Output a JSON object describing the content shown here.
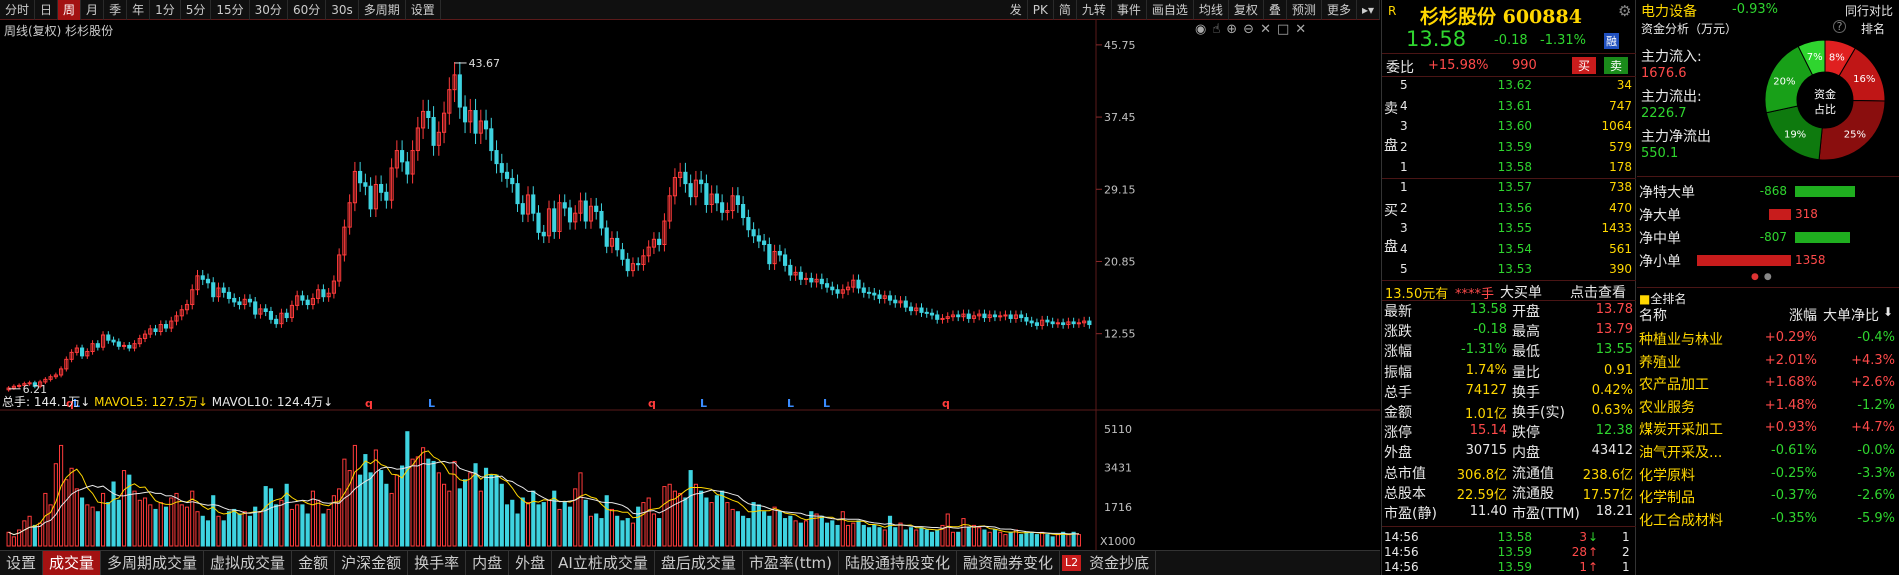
{
  "toolbar": {
    "items": [
      "分时",
      "日",
      "周",
      "月",
      "季",
      "年",
      "1分",
      "5分",
      "15分",
      "30分",
      "60分",
      "30s",
      "多周期",
      "设置"
    ],
    "active": "周",
    "right_items": [
      "发",
      "PK",
      "简",
      "九转",
      "事件",
      "画自选",
      "均线",
      "复权",
      "叠",
      "预测",
      "更多"
    ]
  },
  "chart": {
    "subtitle": "周线(复权) 杉杉股份",
    "max_label": "43.67",
    "min_label": "6.21",
    "price_ticks": [
      "45.75",
      "37.45",
      "29.15",
      "20.85",
      "12.55"
    ],
    "vol_ticks": [
      "5110",
      "3431",
      "1716",
      "X1000"
    ],
    "markers": [
      "q",
      "L",
      "q",
      "L",
      "q",
      "L",
      "L",
      "L",
      "q"
    ]
  },
  "volume_legend": {
    "total": "总手: 144.1万↓",
    "ma5": "MAVOL5: 127.5万↓",
    "ma10": "MAVOL10: 124.4万↓"
  },
  "bottom_tabs": [
    "设置",
    "成交量",
    "多周期成交量",
    "虚拟成交量",
    "金额",
    "沪深金额",
    "换手率",
    "内盘",
    "外盘",
    "AI立桩成交量",
    "盘后成交量",
    "市盈率(ttm)",
    "陆股通持股变化",
    "融资融券变化",
    "资金抄底"
  ],
  "bottom_active": "成交量",
  "bottom_badge": "L2",
  "quote": {
    "title": "杉杉股份 600884",
    "price": "13.58",
    "change": "-0.18",
    "pct": "-1.31%",
    "badge": "融",
    "r_icon": "R"
  },
  "weibi": {
    "label": "委比",
    "value": "+15.98%",
    "diff": "990",
    "buy": "买",
    "sell": "卖"
  },
  "sell_book": [
    [
      "5",
      "13.62",
      "34"
    ],
    [
      "4",
      "13.61",
      "747"
    ],
    [
      "3",
      "13.60",
      "1064"
    ],
    [
      "2",
      "13.59",
      "579"
    ],
    [
      "1",
      "13.58",
      "178"
    ]
  ],
  "buy_book": [
    [
      "1",
      "13.57",
      "738"
    ],
    [
      "2",
      "13.56",
      "470"
    ],
    [
      "3",
      "13.55",
      "1433"
    ],
    [
      "4",
      "13.54",
      "561"
    ],
    [
      "5",
      "13.53",
      "390"
    ]
  ],
  "book_side_labels": {
    "sell": [
      "卖",
      "盘"
    ],
    "buy": [
      "买",
      "盘"
    ]
  },
  "bigorder": {
    "price": "13.50元有",
    "hand": "****手",
    "label": "大买单",
    "link": "点击查看"
  },
  "stats": [
    [
      "最新",
      "13.58",
      "开盘",
      "13.78"
    ],
    [
      "涨跌",
      "-0.18",
      "最高",
      "13.79"
    ],
    [
      "涨幅",
      "-1.31%",
      "最低",
      "13.55"
    ],
    [
      "振幅",
      "1.74%",
      "量比",
      "0.91"
    ],
    [
      "总手",
      "74127",
      "换手",
      "0.42%"
    ],
    [
      "金额",
      "1.01亿",
      "换手(实)",
      "0.63%"
    ],
    [
      "涨停",
      "15.14",
      "跌停",
      "12.38"
    ],
    [
      "外盘",
      "30715",
      "内盘",
      "43412"
    ],
    [
      "总市值",
      "306.8亿",
      "流通值",
      "238.6亿"
    ],
    [
      "总股本",
      "22.59亿",
      "流通股",
      "17.57亿"
    ],
    [
      "市盈(静)",
      "11.40",
      "市盈(TTM)",
      "18.21"
    ]
  ],
  "ticks": [
    [
      "14:56",
      "13.58",
      "3",
      "↓",
      "1"
    ],
    [
      "14:56",
      "13.59",
      "28",
      "↑",
      "2"
    ],
    [
      "14:56",
      "13.59",
      "1",
      "↑",
      "1"
    ]
  ],
  "sector": {
    "name": "电力设备",
    "pct": "-0.93%",
    "link": "同行对比"
  },
  "fund": {
    "title": "资金分析（万元）",
    "more": "?",
    "rank": "排名",
    "inflow_label": "主力流入:",
    "inflow": "1676.6",
    "outflow_label": "主力流出:",
    "outflow": "2226.7",
    "net_label": "主力净流出",
    "net": "550.1",
    "donut_center1": "资金",
    "donut_center2": "占比",
    "slices": [
      {
        "label": "8%",
        "value": 8,
        "color": "#e02020"
      },
      {
        "label": "16%",
        "value": 16,
        "color": "#c01616"
      },
      {
        "label": "25%",
        "value": 25,
        "color": "#8a0e0e"
      },
      {
        "label": "19%",
        "value": 19,
        "color": "#0e7a0e"
      },
      {
        "label": "20%",
        "value": 20,
        "color": "#18a018"
      },
      {
        "label": "7%",
        "value": 7,
        "color": "#2fd52f"
      }
    ]
  },
  "net_rows": [
    {
      "label": "净特大单",
      "value": "-868",
      "frac": 0.64,
      "color": "green"
    },
    {
      "label": "净大单",
      "value": "318",
      "frac": 0.23,
      "color": "red"
    },
    {
      "label": "净中单",
      "value": "-807",
      "frac": 0.59,
      "color": "green"
    },
    {
      "label": "净小单",
      "value": "1358",
      "frac": 1.0,
      "color": "red"
    }
  ],
  "ranking": {
    "title": "全排名",
    "headers": [
      "名称",
      "涨幅",
      "大单净比"
    ],
    "rows": [
      [
        "种植业与林业",
        "+0.29%",
        "-0.4%"
      ],
      [
        "养殖业",
        "+2.01%",
        "+4.3%"
      ],
      [
        "农产品加工",
        "+1.68%",
        "+2.6%"
      ],
      [
        "农业服务",
        "+1.48%",
        "-1.2%"
      ],
      [
        "煤炭开采加工",
        "+0.93%",
        "+4.7%"
      ],
      [
        "油气开采及...",
        "-0.61%",
        "-0.0%"
      ],
      [
        "化学原料",
        "-0.25%",
        "-3.3%"
      ],
      [
        "化学制品",
        "-0.37%",
        "-2.6%"
      ],
      [
        "化工合成材料",
        "-0.35%",
        "-5.9%"
      ]
    ]
  },
  "chart_data": {
    "type": "candlestick",
    "x_unit": "week",
    "ylim": [
      5.5,
      47
    ],
    "price_ticks": [
      45.75,
      37.45,
      29.15,
      20.85,
      12.55
    ],
    "high_marker": 43.67,
    "low_marker": 6.21,
    "closes": [
      6.3,
      6.5,
      6.6,
      6.8,
      6.9,
      6.5,
      7.0,
      7.3,
      7.6,
      7.8,
      8.5,
      9.6,
      10.4,
      10.9,
      10.0,
      10.5,
      11.4,
      11.0,
      12.4,
      11.8,
      11.6,
      11.1,
      11.2,
      10.9,
      11.4,
      12.0,
      12.5,
      13.1,
      12.8,
      13.6,
      13.2,
      14.0,
      14.6,
      15.3,
      15.9,
      17.6,
      19.2,
      18.8,
      18.4,
      16.8,
      17.8,
      17.3,
      16.6,
      16.2,
      15.9,
      16.5,
      16.2,
      14.8,
      15.4,
      15.1,
      14.2,
      13.7,
      14.9,
      14.4,
      15.8,
      16.9,
      16.4,
      15.9,
      16.6,
      17.6,
      16.8,
      17.2,
      18.6,
      21.6,
      24.8,
      27.6,
      31.2,
      29.9,
      29.5,
      26.9,
      29.7,
      28.8,
      27.9,
      31.6,
      33.6,
      32.3,
      30.9,
      33.6,
      36.2,
      38.1,
      37.4,
      34.2,
      35.7,
      37.9,
      40.6,
      42.3,
      38.6,
      36.9,
      38.2,
      35.6,
      37.0,
      36.1,
      33.6,
      32.1,
      31.1,
      30.4,
      29.8,
      27.5,
      26.3,
      28.5,
      26.4,
      24.2,
      23.8,
      26.9,
      24.3,
      27.6,
      27.0,
      25.4,
      26.4,
      27.8,
      25.5,
      27.2,
      26.6,
      24.7,
      22.6,
      23.5,
      22.2,
      21.1,
      19.8,
      20.6,
      20.5,
      21.5,
      22.5,
      23.4,
      22.8,
      25.5,
      28.4,
      30.5,
      31.1,
      29.8,
      28.3,
      30.2,
      29.8,
      27.4,
      28.6,
      27.6,
      26.5,
      26.7,
      28.4,
      27.4,
      25.9,
      24.5,
      23.8,
      23.2,
      22.8,
      20.6,
      22.0,
      21.6,
      20.4,
      19.3,
      19.6,
      18.8,
      18.9,
      18.5,
      18.8,
      18.3,
      17.9,
      17.6,
      17.2,
      17.6,
      17.9,
      18.7,
      17.8,
      17.3,
      17.2,
      17.0,
      16.6,
      16.9,
      16.4,
      16.1,
      16.3,
      15.6,
      15.2,
      15.5,
      15.0,
      14.9,
      14.7,
      14.2,
      14.3,
      14.5,
      14.7,
      14.5,
      14.8,
      14.3,
      14.6,
      14.8,
      14.4,
      14.7,
      14.5,
      14.6,
      14.7,
      14.3,
      14.7,
      14.4,
      14.0,
      13.8,
      13.5,
      14.1,
      13.9,
      13.7,
      13.8,
      13.6,
      13.9,
      13.7,
      13.8,
      14.0,
      13.6
    ],
    "volumes_k": [
      600,
      400,
      700,
      1100,
      1300,
      900,
      1000,
      2300,
      1800,
      3600,
      4400,
      2900,
      3400,
      2500,
      2100,
      1800,
      1700,
      1500,
      2300,
      1900,
      2800,
      2000,
      3300,
      3100,
      2400,
      2000,
      2100,
      1800,
      1600,
      1900,
      1700,
      2100,
      2300,
      1800,
      1700,
      2400,
      1500,
      1300,
      1100,
      2200,
      1300,
      1100,
      1500,
      1600,
      1400,
      1500,
      1300,
      1700,
      1500,
      2600,
      2500,
      1800,
      2000,
      2700,
      1600,
      1800,
      1800,
      1400,
      2400,
      2000,
      1400,
      1600,
      2200,
      2500,
      3800,
      3300,
      4400,
      3100,
      4000,
      3200,
      4200,
      3300,
      2700,
      2300,
      3100,
      3500,
      5000,
      3800,
      3900,
      4300,
      3800,
      3700,
      3200,
      2700,
      2400,
      3700,
      2500,
      2900,
      3200,
      3600,
      2400,
      3400,
      3100,
      3100,
      2700,
      1800,
      2000,
      1400,
      2100,
      1900,
      2400,
      1800,
      1900,
      2000,
      2400,
      1600,
      1900,
      1700,
      2500,
      3200,
      2000,
      1300,
      1400,
      1200,
      2200,
      1600,
      1300,
      1100,
      1200,
      1000,
      1700,
      1900,
      2100,
      1400,
      1200,
      2600,
      2700,
      2400,
      2300,
      2100,
      3300,
      2700,
      2400,
      2100,
      1900,
      2200,
      2400,
      1900,
      1600,
      1500,
      1300,
      1200,
      1900,
      1800,
      1500,
      1300,
      1700,
      1500,
      1200,
      1300,
      1100,
      1000,
      1100,
      1500,
      1400,
      1300,
      1000,
      1100,
      900,
      1500,
      900,
      1000,
      1100,
      900,
      800,
      900,
      800,
      700,
      1300,
      800,
      1000,
      700,
      800,
      700,
      800,
      700,
      600,
      700,
      900,
      1400,
      600,
      600,
      1200,
      800,
      900,
      800,
      700,
      600,
      700,
      600,
      500,
      600,
      700,
      500,
      600,
      600,
      500,
      600,
      500,
      400,
      500,
      600,
      500,
      600,
      500
    ]
  }
}
